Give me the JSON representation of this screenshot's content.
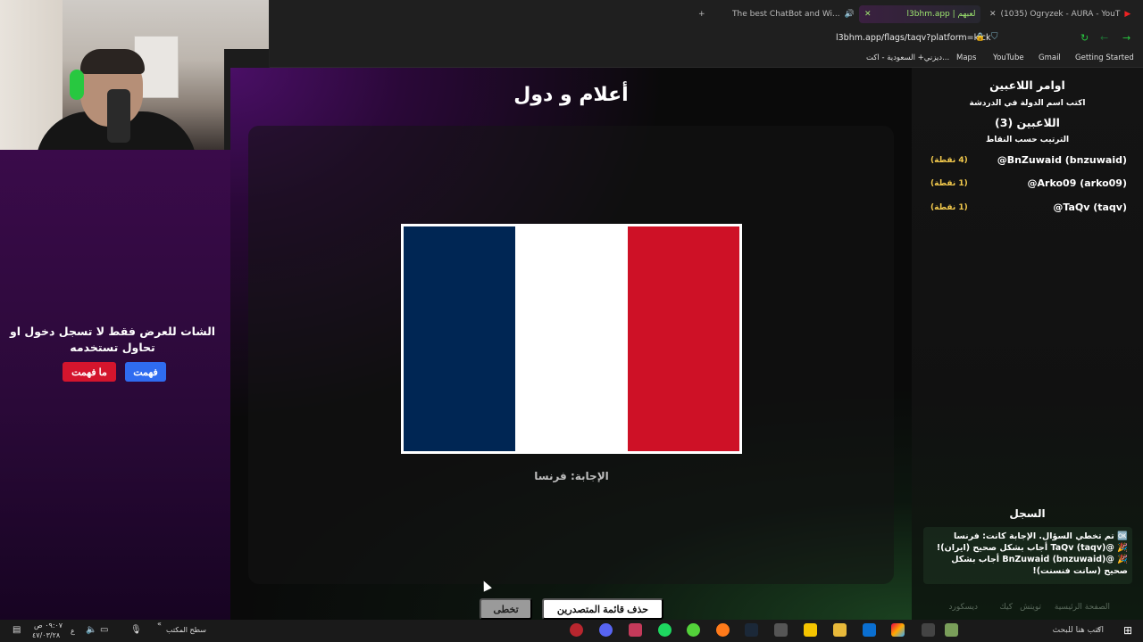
{
  "browser": {
    "tabs": [
      {
        "label": "The best ChatBot and Wi...",
        "active": false
      },
      {
        "label": "l3bhm.app | لعبهم",
        "active": true
      },
      {
        "label": "(1035) Ogryzek - AURA - YouT",
        "active": false
      }
    ],
    "new_tab_symbol": "+",
    "url": "l3bhm.app/flags/taqv?platform=kick",
    "bookmarks": [
      "Getting Started",
      "Gmail",
      "YouTube",
      "Maps",
      "ديزني+ السعودية - اكت..."
    ]
  },
  "overlay": {
    "notice": "الشات للعرض فقط لا تسجل دخول او تحاول تستخدمه",
    "understood_label": "فهمت",
    "not_understood_label": "ما فهمت"
  },
  "game": {
    "title": "أعلام و دول",
    "answer": "الإجابة: فرنسا",
    "skip_label": "تخطى",
    "clear_leaderboard_label": "حذف قائمة المتصدرين",
    "flag_colors": [
      "#002654",
      "#ffffff",
      "#ce1126"
    ]
  },
  "sidebar": {
    "commands_title": "اوامر اللاعبين",
    "commands_sub": "اكتب اسم الدولة في الدردشة",
    "players_title": "اللاعبين (3)",
    "sort_label": "الترتيب حسب النقاط",
    "players": [
      {
        "name": "@BnZuwaid (bnzuwaid)",
        "score": "(4 نقطة)"
      },
      {
        "name": "@Arko09 (arko09)",
        "score": "(1 نقطة)"
      },
      {
        "name": "@TaQv (taqv)",
        "score": "(1 نقطة)"
      }
    ],
    "log_title": "السجل",
    "log": [
      "🆗 تم تخطي السؤال. الإجابة كانت: فرنسا",
      "🎉 @TaQv (taqv) أجاب بشكل صحيح (ايران)!",
      "🎉 @BnZuwaid (bnzuwaid) أجاب بشكل صحيح (سانت فنسنت)!"
    ],
    "footer_links": [
      "الصفحة الرئيسية",
      "تويتش",
      "كيك",
      "ديسكورد"
    ]
  },
  "taskbar": {
    "search_placeholder": "اكتب هنا للبحث",
    "desktop_label": "سطح المكتب",
    "time": "٠٩:٠٧ ص",
    "date": "٤٧/٠٣/٢٨",
    "lang": "ع",
    "chevron": "«"
  }
}
